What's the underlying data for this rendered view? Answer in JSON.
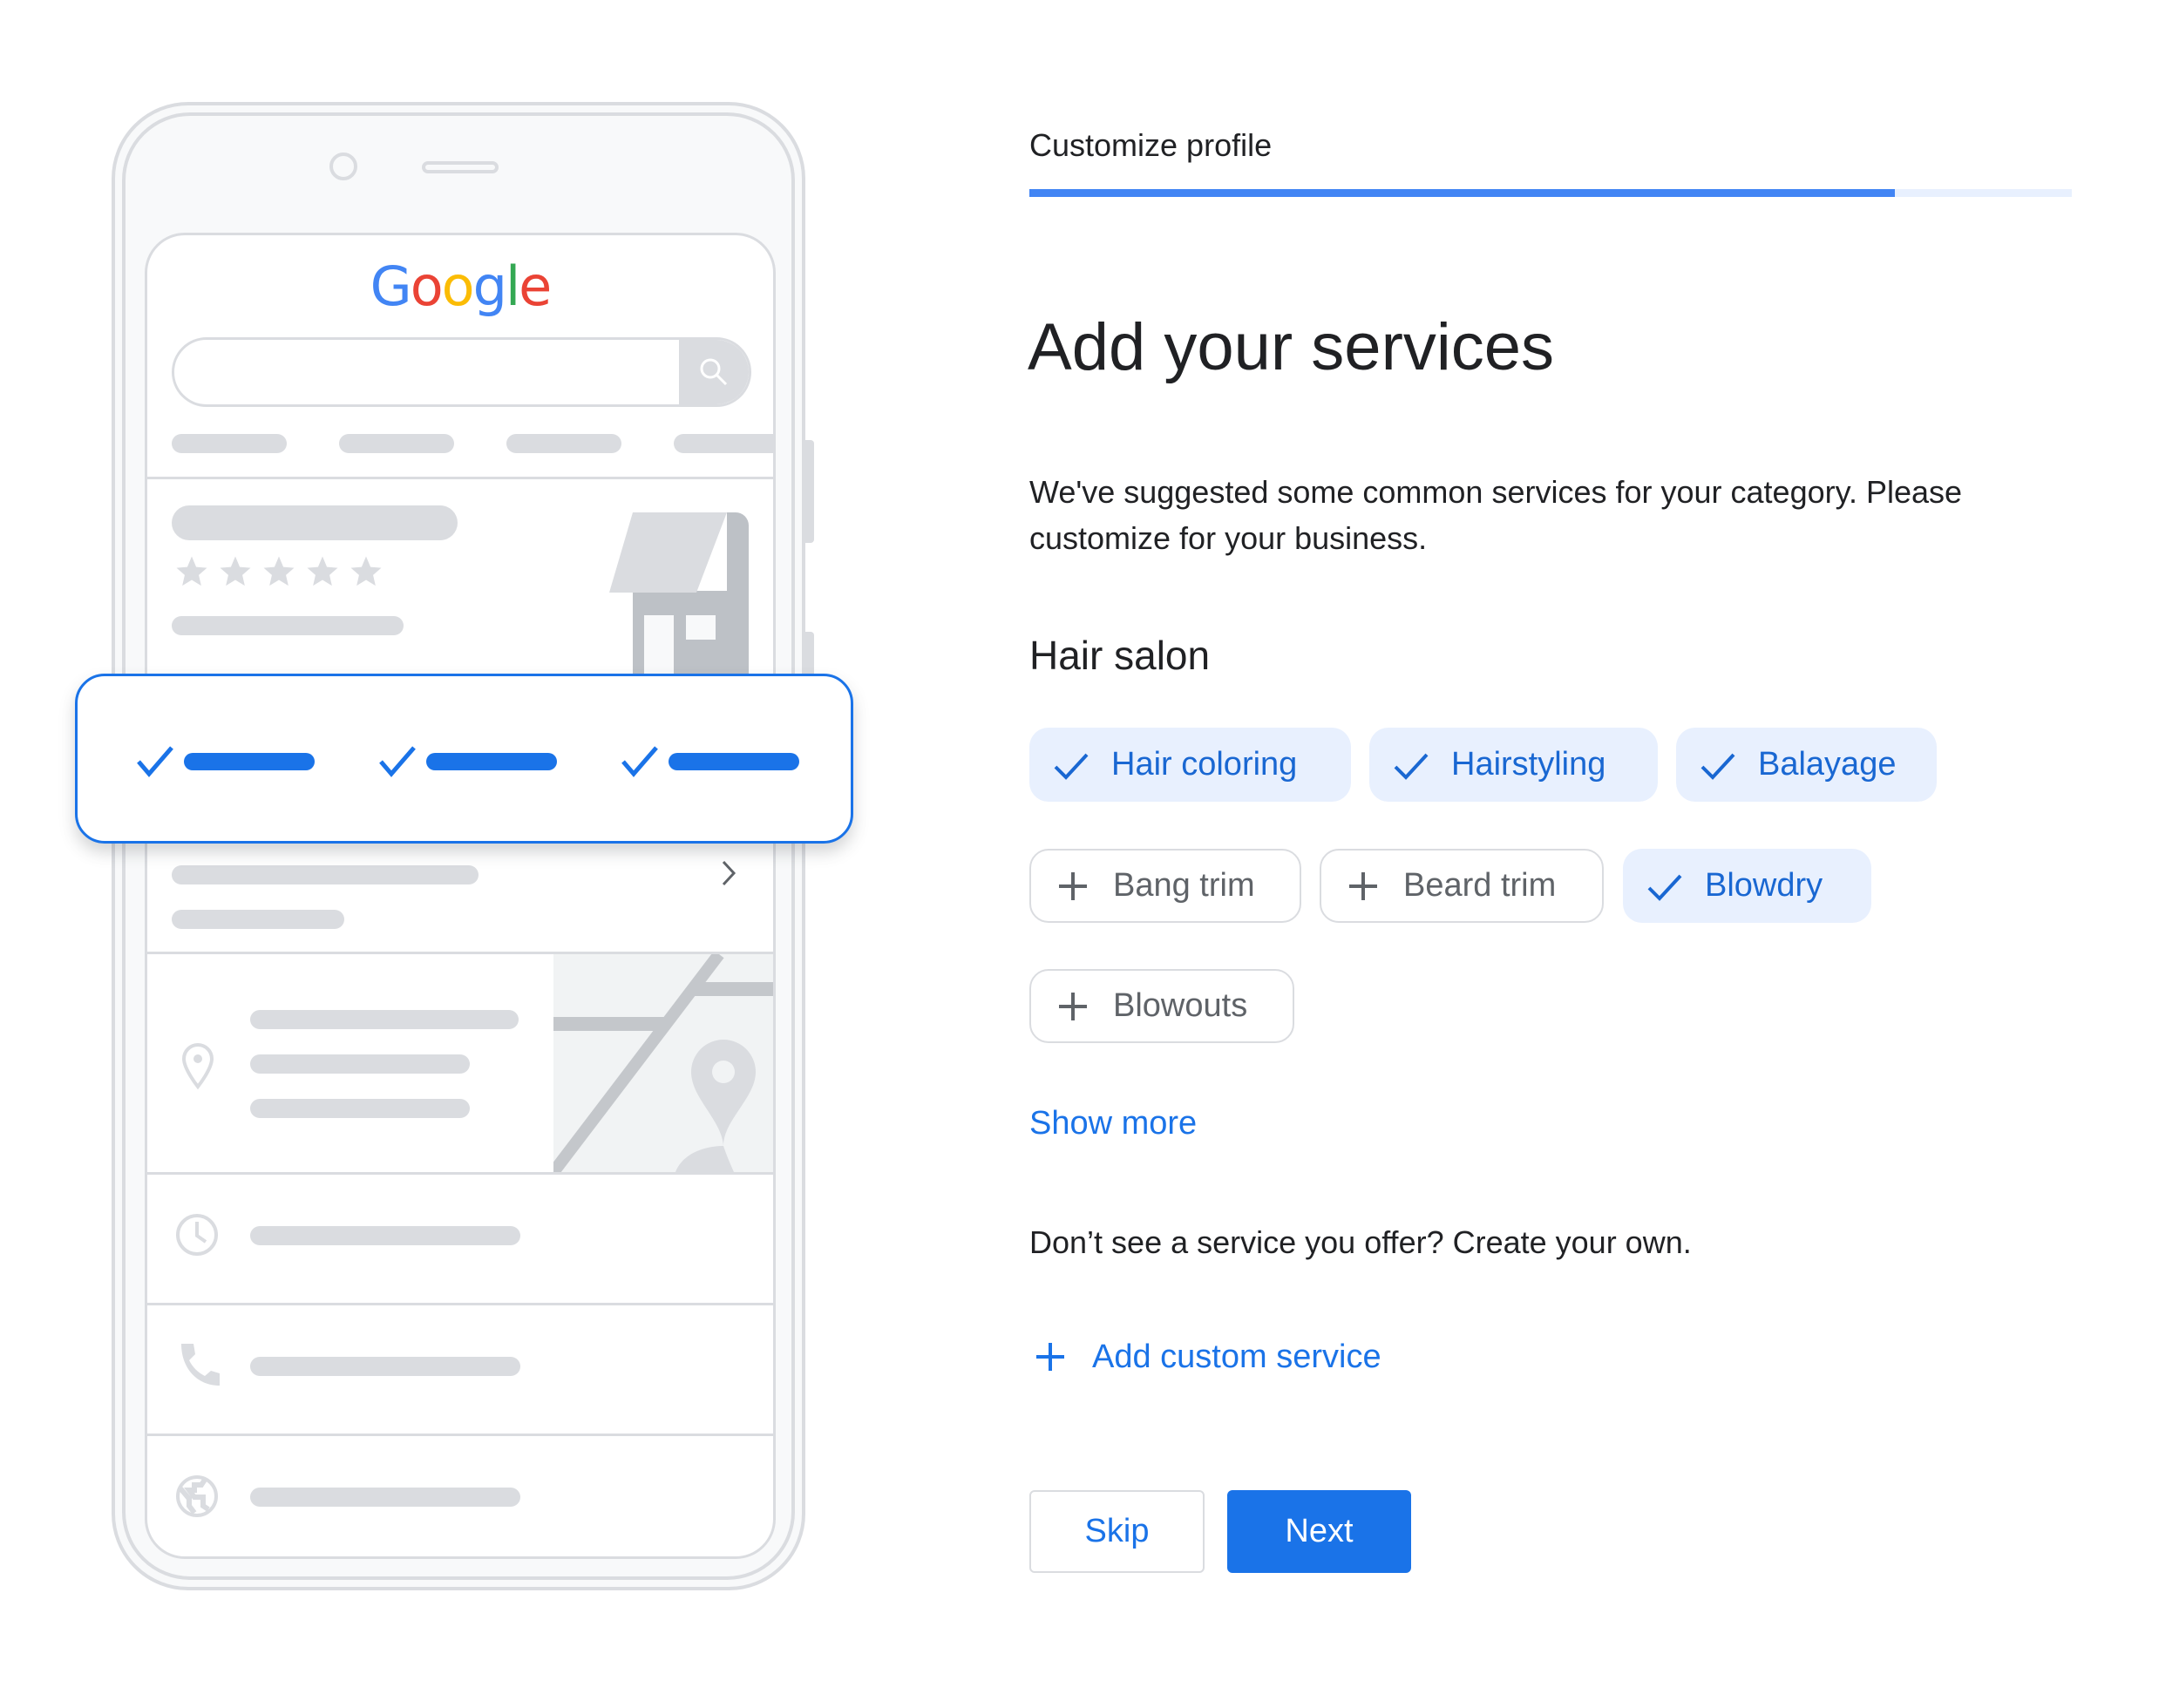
{
  "illustration": {
    "logo_letters": [
      {
        "char": "G",
        "color": "#4285f4"
      },
      {
        "char": "o",
        "color": "#ea4335"
      },
      {
        "char": "o",
        "color": "#fbbc05"
      },
      {
        "char": "g",
        "color": "#4285f4"
      },
      {
        "char": "l",
        "color": "#34a853"
      },
      {
        "char": "e",
        "color": "#ea4335"
      }
    ],
    "star_count": 5
  },
  "header": {
    "step_label": "Customize profile",
    "progress": 0.83
  },
  "main": {
    "title": "Add your services",
    "description": "We've suggested some common services for your category. Please customize for your business.",
    "category": "Hair salon",
    "services": [
      {
        "label": "Hair coloring",
        "selected": true
      },
      {
        "label": "Hairstyling",
        "selected": true
      },
      {
        "label": "Balayage",
        "selected": true
      },
      {
        "label": "Bang trim",
        "selected": false
      },
      {
        "label": "Beard trim",
        "selected": false
      },
      {
        "label": "Blowdry",
        "selected": true
      },
      {
        "label": "Blowouts",
        "selected": false
      }
    ],
    "show_more": "Show more",
    "custom_prompt": "Don’t see a service you offer? Create your own.",
    "add_custom": "Add custom service"
  },
  "actions": {
    "skip": "Skip",
    "next": "Next"
  },
  "colors": {
    "accent": "#1a73e8",
    "progress": "#4285f4",
    "chip_selected_bg": "#e8f0fe"
  }
}
